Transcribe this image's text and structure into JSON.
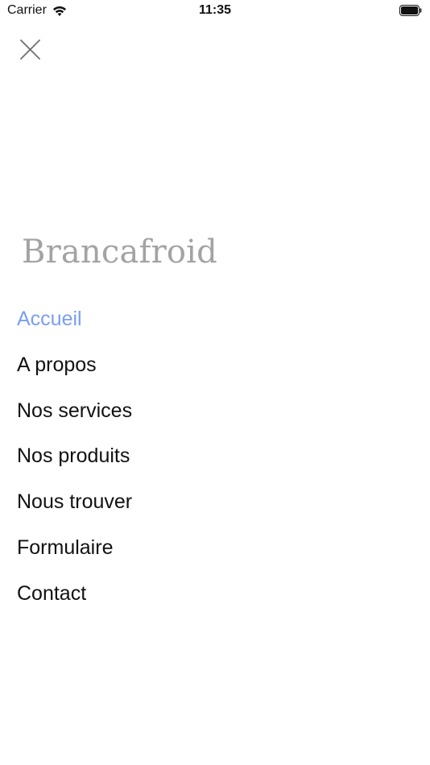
{
  "status_bar": {
    "carrier": "Carrier",
    "time": "11:35",
    "icons": {
      "wifi": "wifi-icon",
      "battery": "battery-icon"
    }
  },
  "header": {
    "close_icon": "close-icon"
  },
  "brand": {
    "name": "Brancafroid",
    "color": "#a3a3a3"
  },
  "menu": {
    "active_color": "#7b9ef0",
    "items": [
      {
        "label": "Accueil",
        "active": true
      },
      {
        "label": "A propos",
        "active": false
      },
      {
        "label": "Nos services",
        "active": false
      },
      {
        "label": "Nos produits",
        "active": false
      },
      {
        "label": "Nous trouver",
        "active": false
      },
      {
        "label": "Formulaire",
        "active": false
      },
      {
        "label": "Contact",
        "active": false
      }
    ]
  }
}
